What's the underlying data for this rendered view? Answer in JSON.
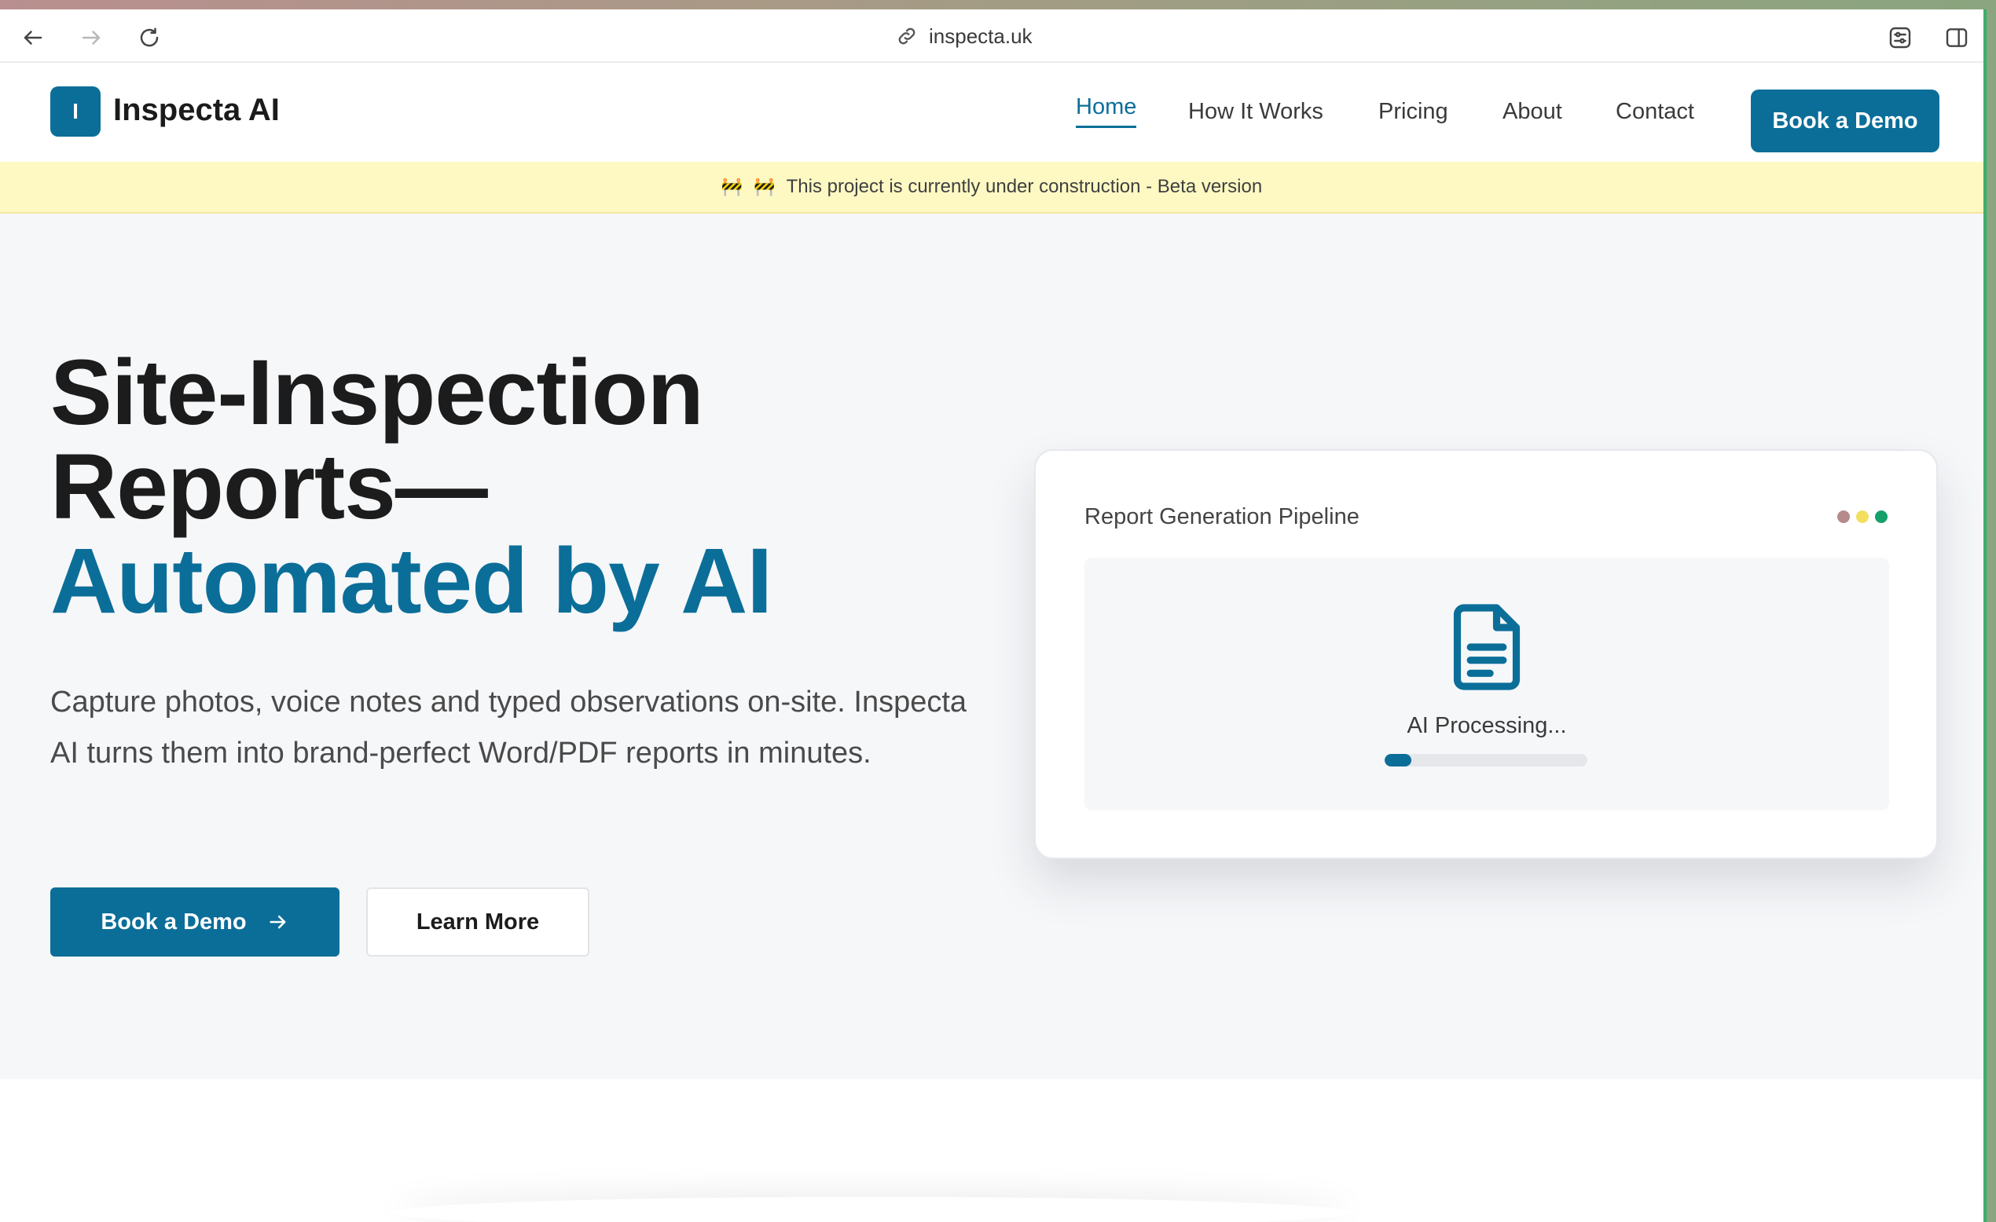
{
  "browser": {
    "url": "inspecta.uk"
  },
  "brand": {
    "logo_letter": "I",
    "name": "Inspecta AI",
    "primary_color": "#0b6e99"
  },
  "nav": {
    "items": [
      {
        "label": "Home",
        "active": true
      },
      {
        "label": "How It Works",
        "active": false
      },
      {
        "label": "Pricing",
        "active": false
      },
      {
        "label": "About",
        "active": false
      },
      {
        "label": "Contact",
        "active": false
      }
    ],
    "cta_label": "Book a Demo"
  },
  "banner": {
    "icon_1": "🚧",
    "icon_2": "🚧",
    "text": "This project is currently under construction - Beta version",
    "background": "#fef9c3"
  },
  "hero": {
    "title_line1": "Site-Inspection",
    "title_line2": "Reports—",
    "title_accent": "Automated by AI",
    "subtitle": "Capture photos, voice notes and typed observations on-site. Inspecta AI turns them into brand-perfect Word/PDF reports in minutes.",
    "primary_button": "Book a Demo",
    "secondary_button": "Learn More"
  },
  "pipeline_card": {
    "title": "Report Generation Pipeline",
    "dot_colors": [
      "#b48a8a",
      "#f2df5e",
      "#14a06a"
    ],
    "status": "AI Processing...",
    "progress_fraction": 0.13,
    "icon": "document-icon"
  }
}
